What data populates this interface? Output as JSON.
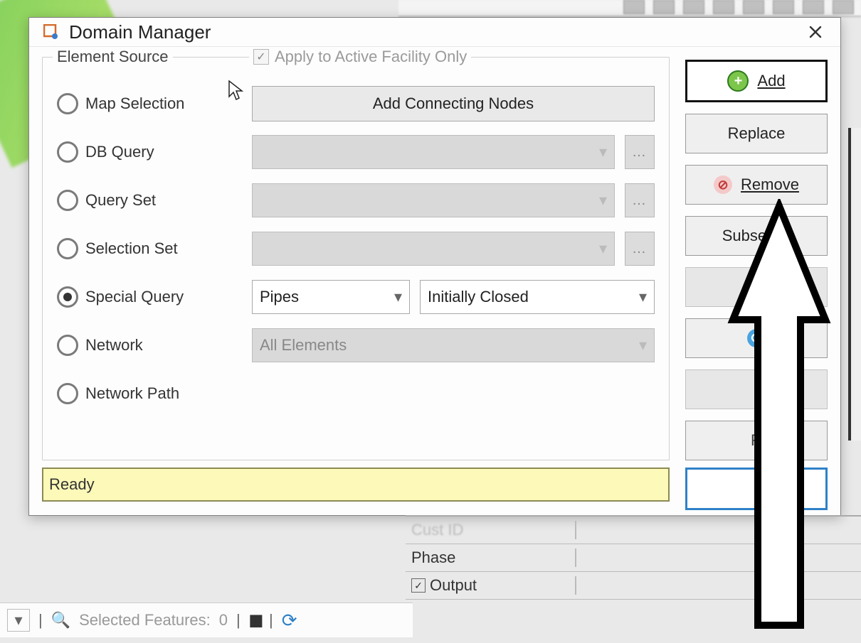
{
  "dialog": {
    "title": "Domain Manager",
    "group_legend": "Element Source",
    "apply_checkbox": {
      "label": "Apply to Active Facility Only",
      "checked": true,
      "enabled": false
    },
    "addConnectingNodes": "Add Connecting Nodes",
    "radios": {
      "map_selection": "Map Selection",
      "db_query": "DB Query",
      "query_set": "Query Set",
      "selection_set": "Selection Set",
      "special_query": "Special Query",
      "network": "Network",
      "network_path": "Network Path",
      "selected": "special_query"
    },
    "special_query": {
      "type_value": "Pipes",
      "condition_value": "Initially Closed"
    },
    "network_combo_value": "All Elements",
    "status": "Ready"
  },
  "actions": {
    "add": "Add",
    "replace": "Replace",
    "remove": "Remove",
    "subselect": "Subselect",
    "r_partial": "R"
  },
  "background": {
    "props": {
      "cust_id": "Cust ID",
      "phase": "Phase",
      "output": "Output",
      "output_checked": true
    },
    "statusbar": {
      "selected_features_label": "Selected Features:",
      "selected_features_count": "0"
    }
  }
}
